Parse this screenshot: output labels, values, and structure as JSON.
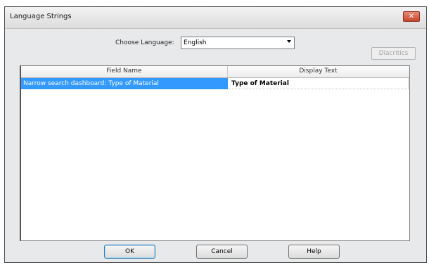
{
  "dialog": {
    "title": "Language Strings",
    "close_icon": "close-icon"
  },
  "language": {
    "label": "Choose Language:",
    "selected": "English"
  },
  "buttons": {
    "diacritics": "Diacritics",
    "ok": "OK",
    "cancel": "Cancel",
    "help": "Help"
  },
  "table": {
    "columns": [
      "Field Name",
      "Display Text"
    ],
    "rows": [
      {
        "field_name": "Narrow search dashboard: Type of Material",
        "display_text": "Type of Material",
        "selected": true
      }
    ]
  },
  "colors": {
    "selection": "#3399ff",
    "close_button": "#c6462c"
  }
}
